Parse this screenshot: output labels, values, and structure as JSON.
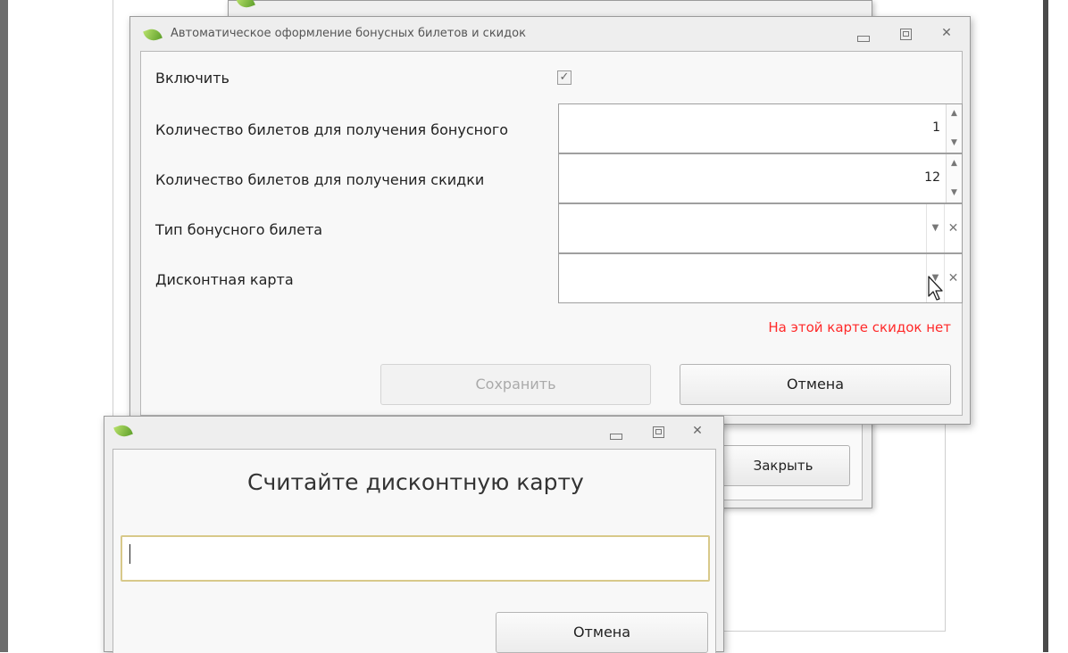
{
  "main_dialog": {
    "title": "Автоматическое оформление бонусных билетов и скидок",
    "fields": {
      "enable_label": "Включить",
      "enable_checked": true,
      "bonus_count_label": "Количество билетов для получения бонусного",
      "bonus_count_value": "1",
      "discount_count_label": "Количество билетов для получения скидки",
      "discount_count_value": "12",
      "bonus_type_label": "Тип бонусного билета",
      "bonus_type_value": "",
      "discount_card_label": "Дисконтная карта",
      "discount_card_value": ""
    },
    "error_message": "На этой карте скидок нет",
    "save_label": "Сохранить",
    "cancel_label": "Отмена"
  },
  "back_window": {
    "close_label": "Закрыть"
  },
  "card_dialog": {
    "heading": "Считайте дисконтную карту",
    "input_value": "",
    "cancel_label": "Отмена"
  },
  "icons": {
    "app": "leaf-icon",
    "minimize": "minimize-icon",
    "maximize": "maximize-icon",
    "close": "close-icon",
    "spin_up": "spin-up-icon",
    "spin_down": "spin-down-icon",
    "dropdown": "chevron-down-icon",
    "clear": "clear-icon",
    "cursor": "mouse-pointer-icon"
  },
  "colors": {
    "error": "#ff2a2a",
    "input_focus_border": "#d8c98a",
    "window_bg": "#eeeeee"
  }
}
